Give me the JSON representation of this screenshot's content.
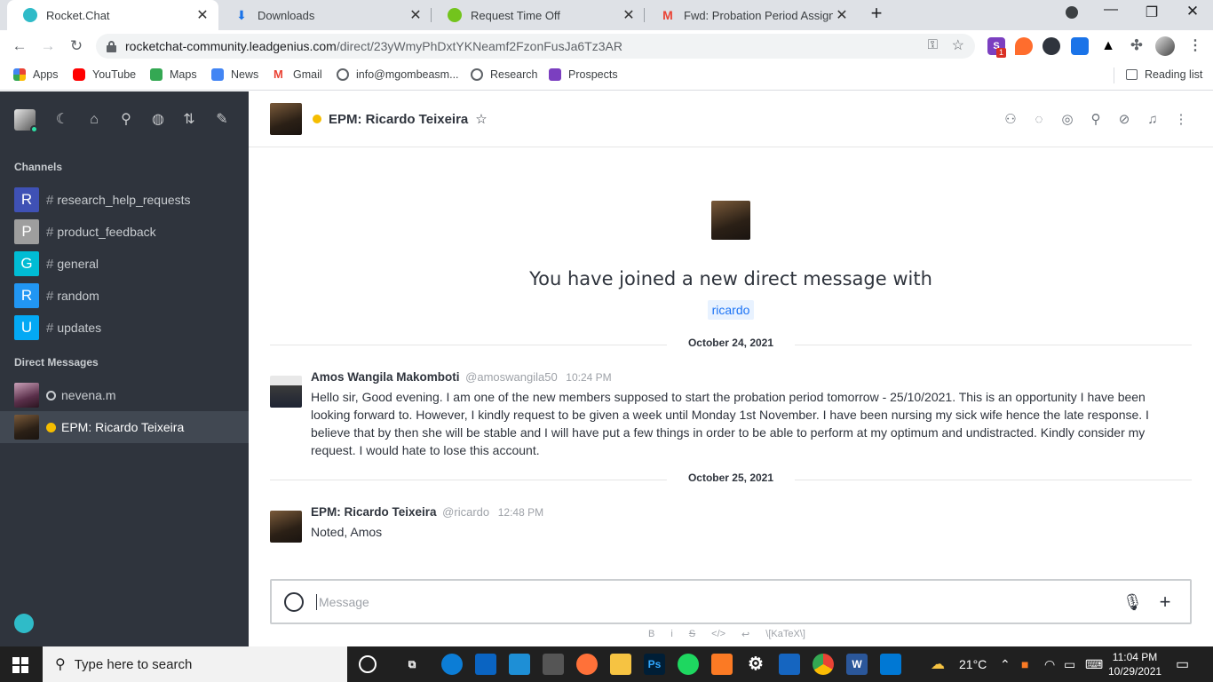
{
  "browser": {
    "tabs": [
      {
        "label": "Rocket.Chat",
        "active": true,
        "icon": "rocketchat-icon",
        "color": "#2fbbc8"
      },
      {
        "label": "Downloads",
        "active": false,
        "icon": "download-icon",
        "color": "#1a73e8"
      },
      {
        "label": "Request Time Off",
        "active": false,
        "icon": "bamboohr-icon",
        "color": "#73c41d"
      },
      {
        "label": "Fwd: Probation Period Assignmen",
        "active": false,
        "icon": "gmail-icon",
        "color": "#ea4335"
      }
    ],
    "url_host": "rocketchat-community.leadgenius.com",
    "url_path": "/direct/23yWmyPhDxtYKNeamf2FzonFusJa6Tz3AR",
    "bookmarks": [
      {
        "label": "Apps",
        "icon": "apps-grid-icon",
        "color": "#ea4335"
      },
      {
        "label": "YouTube",
        "icon": "youtube-icon",
        "color": "#ff0000"
      },
      {
        "label": "Maps",
        "icon": "maps-icon",
        "color": "#34a853"
      },
      {
        "label": "News",
        "icon": "news-icon",
        "color": "#4285f4"
      },
      {
        "label": "Gmail",
        "icon": "gmail-icon",
        "color": "#ea4335"
      },
      {
        "label": "info@mgombeasm...",
        "icon": "globe-icon",
        "color": "#5f6368"
      },
      {
        "label": "Research",
        "icon": "globe-icon",
        "color": "#5f6368"
      },
      {
        "label": "Prospects",
        "icon": "s-icon",
        "color": "#7b3fc0"
      }
    ],
    "reading_list": "Reading list",
    "extension_badge": "1"
  },
  "sidebar": {
    "channels_title": "Channels",
    "channels": [
      {
        "letter": "R",
        "name": "research_help_requests",
        "color": "#3f51b5"
      },
      {
        "letter": "P",
        "name": "product_feedback",
        "color": "#9e9e9e"
      },
      {
        "letter": "G",
        "name": "general",
        "color": "#00bcd4"
      },
      {
        "letter": "R",
        "name": "random",
        "color": "#2196f3"
      },
      {
        "letter": "U",
        "name": "updates",
        "color": "#03a9f4"
      }
    ],
    "dm_title": "Direct Messages",
    "dms": [
      {
        "name": "nevena.m",
        "status": "offline"
      },
      {
        "name": "EPM: Ricardo Teixeira",
        "status": "away"
      }
    ]
  },
  "room": {
    "title": "EPM: Ricardo Teixeira",
    "intro_text": "You have joined a new direct message with",
    "intro_user": "ricardo"
  },
  "messages": [
    {
      "date": "October 24, 2021",
      "name": "Amos Wangila Makomboti",
      "handle": "@amoswangila50",
      "time": "10:24 PM",
      "text": "Hello sir, Good evening. I am one of the new members supposed to start the probation period tomorrow - 25/10/2021. This is an opportunity I have been looking forward to. However, I kindly request to be given a week until Monday 1st November. I have been nursing my sick wife hence the late response. I believe that by then she will be stable and I will have put a few things in order to be able to perform at my optimum and undistracted. Kindly consider my request. I would hate to lose this account."
    },
    {
      "date": "October 25, 2021",
      "name": "EPM: Ricardo Teixeira",
      "handle": "@ricardo",
      "time": "12:48 PM",
      "text": "Noted, Amos"
    }
  ],
  "composer": {
    "placeholder": "Message",
    "format": [
      "B",
      "i",
      "S",
      "</>",
      "↩",
      "\\[KaTeX\\]"
    ]
  },
  "taskbar": {
    "search_placeholder": "Type here to search",
    "weather": "21°C",
    "time": "11:04 PM",
    "date": "10/29/2021"
  }
}
